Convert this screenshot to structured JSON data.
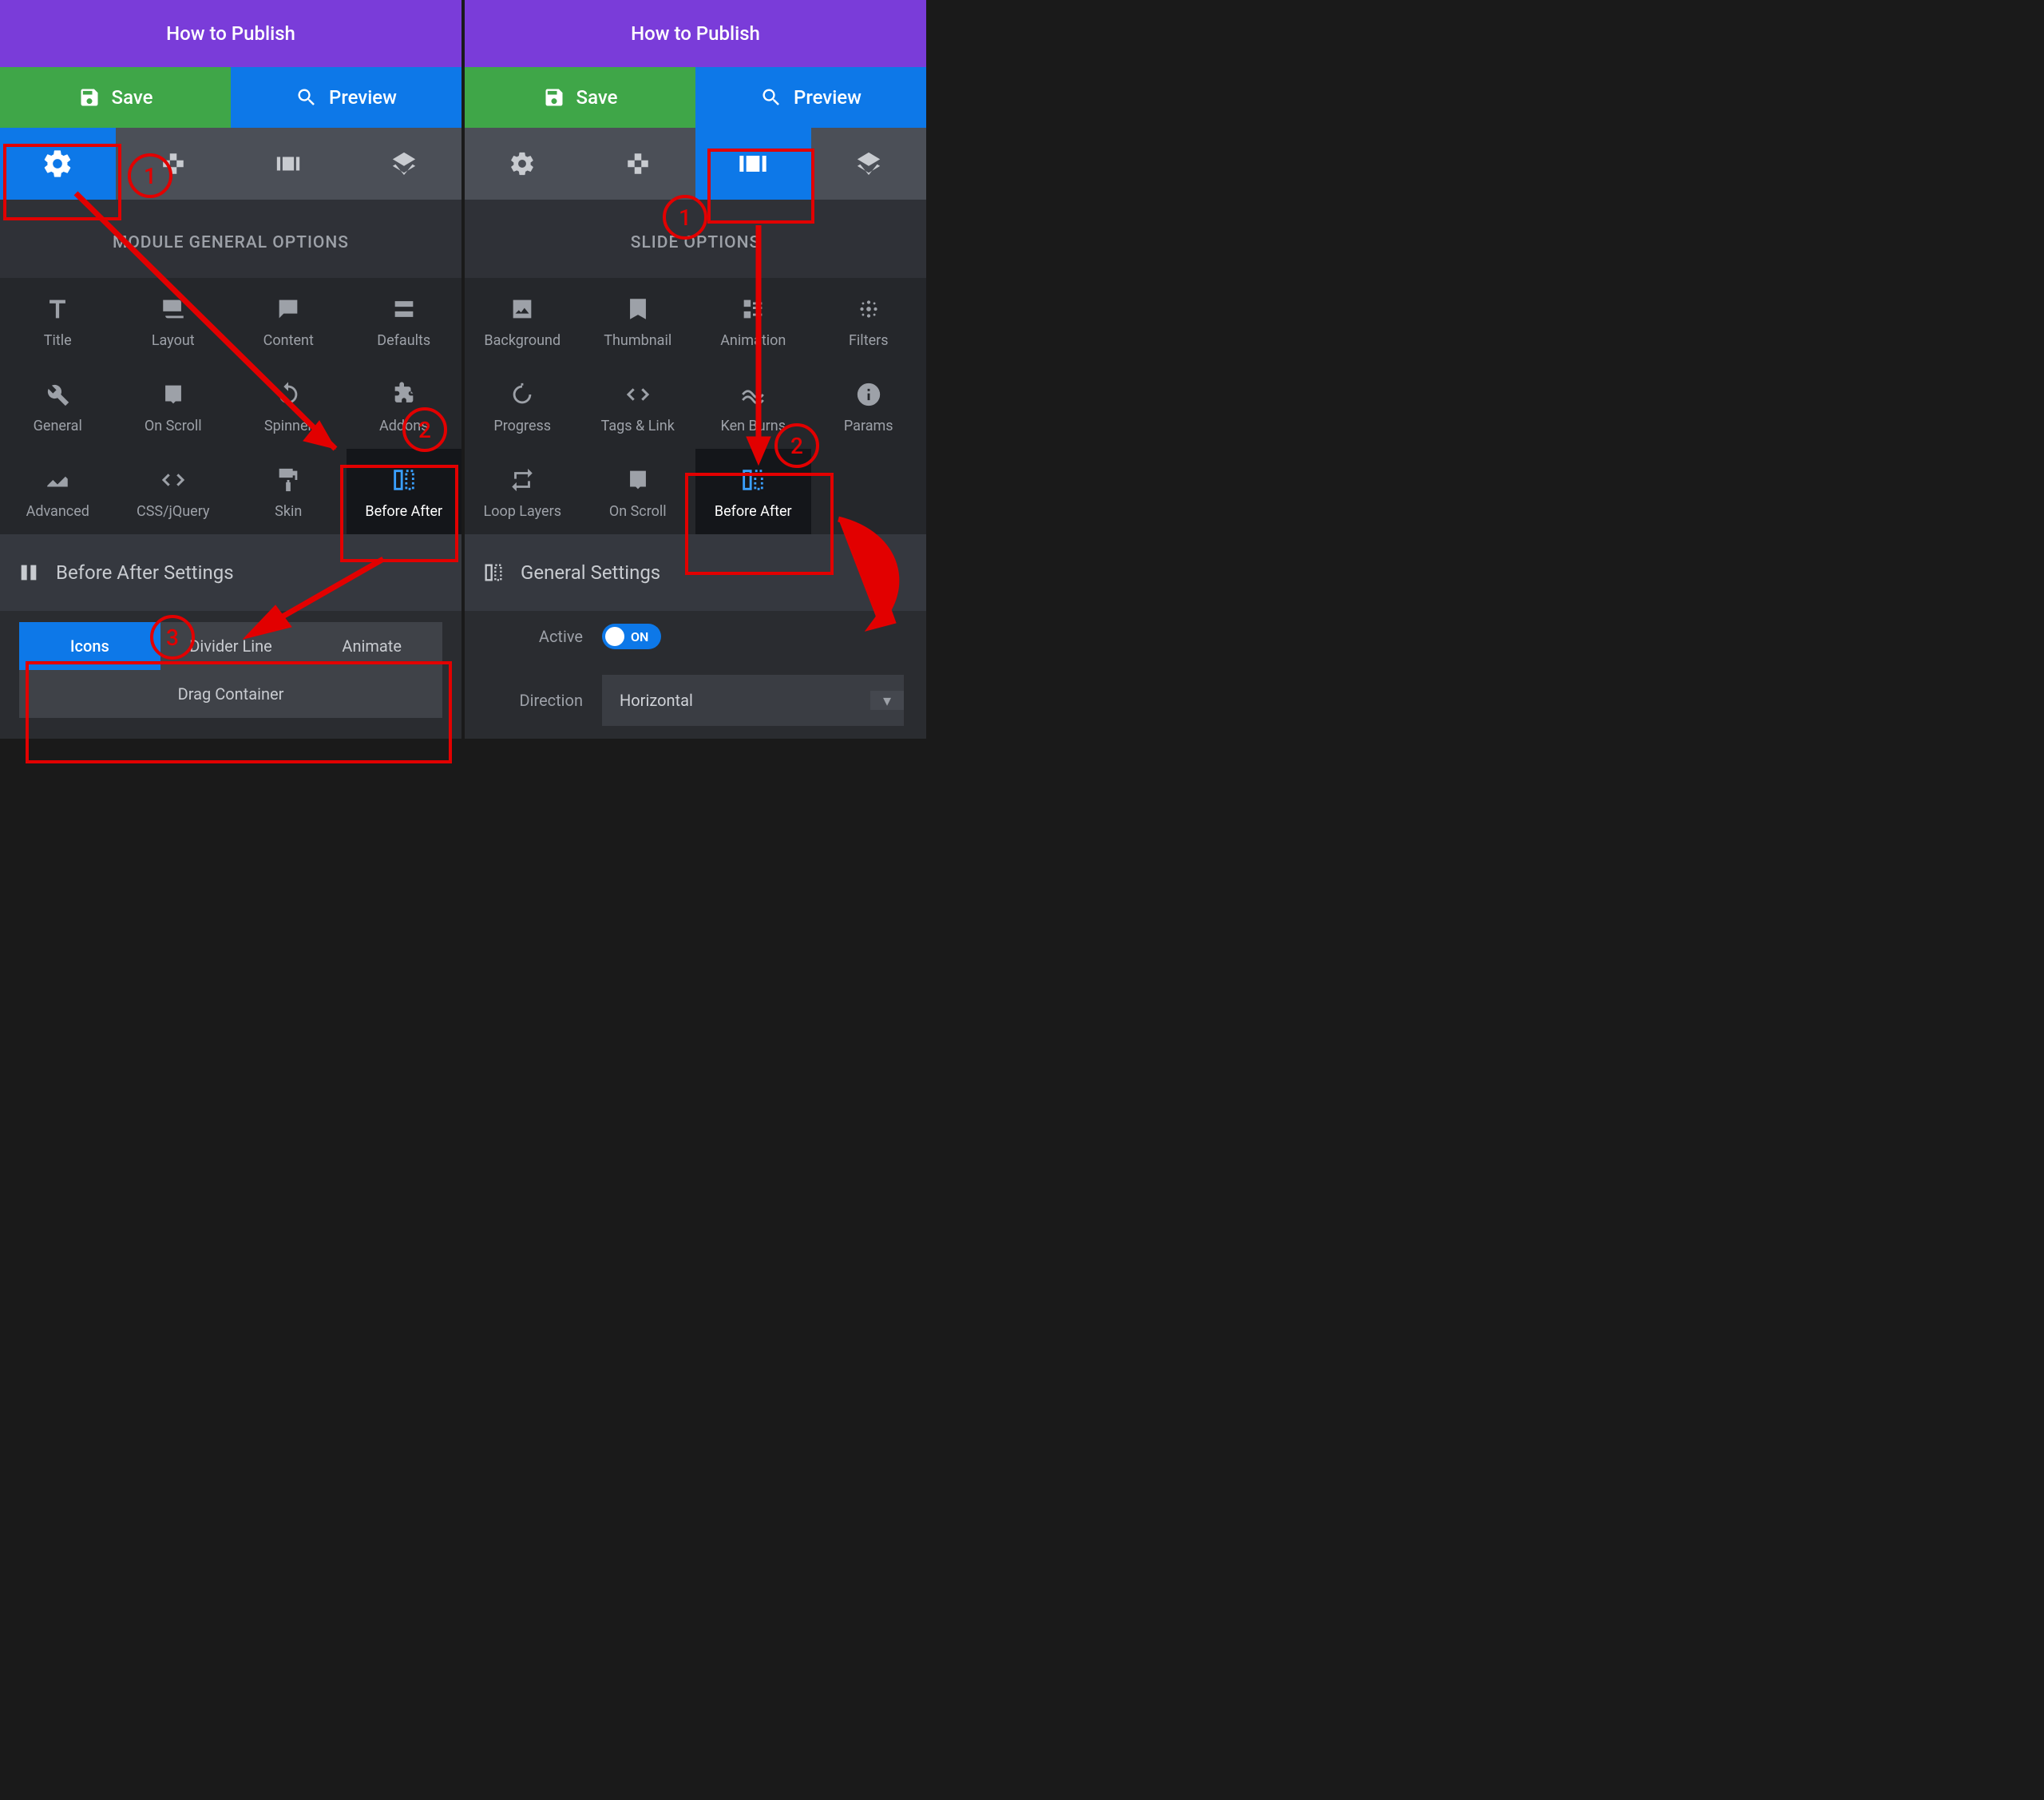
{
  "left": {
    "publish": "How to Publish",
    "save": "Save",
    "preview": "Preview",
    "section_title": "MODULE GENERAL OPTIONS",
    "grid": [
      "Title",
      "Layout",
      "Content",
      "Defaults",
      "General",
      "On Scroll",
      "Spinner",
      "Addons",
      "Advanced",
      "CSS/jQuery",
      "Skin",
      "Before After"
    ],
    "settings_header": "Before After Settings",
    "sub_tabs": [
      "Icons",
      "Divider Line",
      "Animate",
      "Drag Container"
    ]
  },
  "right": {
    "publish": "How to Publish",
    "save": "Save",
    "preview": "Preview",
    "section_title": "SLIDE OPTIONS",
    "grid": [
      "Background",
      "Thumbnail",
      "Animation",
      "Filters",
      "Progress",
      "Tags & Link",
      "Ken Burns",
      "Params",
      "Loop Layers",
      "On Scroll",
      "Before After"
    ],
    "settings_header": "General Settings",
    "active_label": "Active",
    "active_value": "ON",
    "direction_label": "Direction",
    "direction_value": "Horizontal"
  },
  "annotations": {
    "n1": "1",
    "n2": "2",
    "n3": "3"
  }
}
